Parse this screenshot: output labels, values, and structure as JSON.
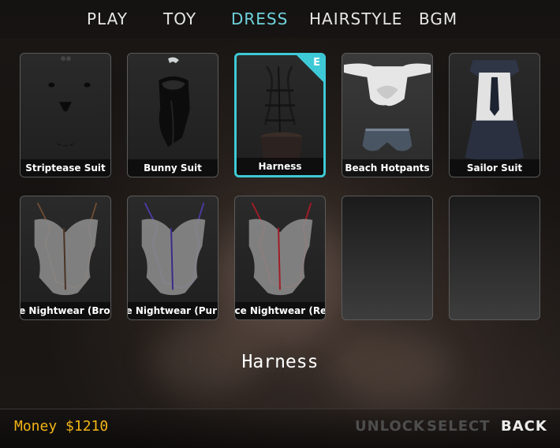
{
  "tabs": [
    {
      "label": "PLAY"
    },
    {
      "label": "TOY"
    },
    {
      "label": "DRESS",
      "active": true
    },
    {
      "label": "HAIRSTYLE"
    },
    {
      "label": "BGM"
    }
  ],
  "items": [
    {
      "label": "Striptease Suit"
    },
    {
      "label": "Bunny Suit"
    },
    {
      "label": "Harness",
      "equipped_badge": "E"
    },
    {
      "label": "Beach Hotpants"
    },
    {
      "label": "Sailor Suit"
    },
    {
      "label": "Lace Nightwear (Brown)"
    },
    {
      "label": "Lace Nightwear (Purple)"
    },
    {
      "label": "Lace Nightwear (Red)"
    }
  ],
  "selected_item_name": "Harness",
  "money_text": "Money $1210",
  "actions": {
    "unlock": "UNLOCK",
    "select": "SELECT",
    "back": "BACK"
  },
  "colors": {
    "accent": "#3ec9d6",
    "active_tab": "#6fd3dc",
    "money": "#f2b416",
    "disabled": "#4d4d4d"
  },
  "icons": {
    "striptease": "striptease-suit-icon",
    "bunny": "bunny-suit-icon",
    "harness": "harness-icon",
    "hotpants": "beach-hotpants-icon",
    "sailor": "sailor-suit-icon",
    "lace": "lace-nightwear-icon"
  }
}
